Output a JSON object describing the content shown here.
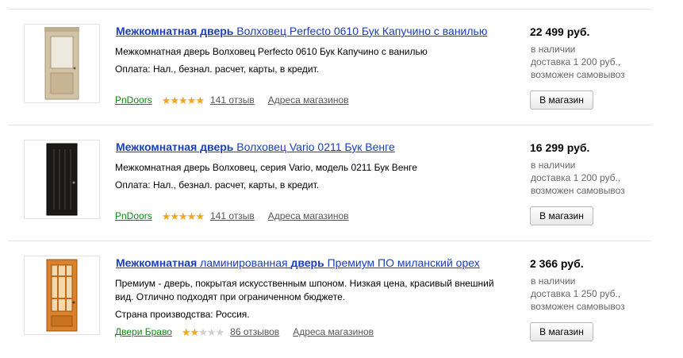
{
  "offers": [
    {
      "title_parts": [
        {
          "text": "Межкомнатная дверь",
          "bold": true
        },
        {
          "text": " Волховец Perfecto 0610 Бук Капучино с ванилью",
          "bold": false
        }
      ],
      "description": [
        "Межкомнатная дверь Волховец Perfecto 0610 Бук Капучино с ванилью",
        "Оплата: Нал., безнал. расчет, карты, в кредит."
      ],
      "shop": "PnDoors",
      "rating": 5,
      "reviews": "141 отзыв",
      "address_link": "Адреса магазинов",
      "price": "22 499 руб.",
      "availability": [
        "в наличии",
        "доставка 1 200 руб.,",
        "возможен самовывоз"
      ],
      "button": "В магазин",
      "door_color": "#c9b79a",
      "door_icon": "door-light-panel-icon"
    },
    {
      "title_parts": [
        {
          "text": "Межкомнатная дверь",
          "bold": true
        },
        {
          "text": " Волховец Vario 0211 Бук Венге",
          "bold": false
        }
      ],
      "description": [
        "Межкомнатная дверь Волховец, серия Vario, модель 0211 Бук Венге",
        "Оплата: Нал., безнал. расчет, карты, в кредит."
      ],
      "shop": "PnDoors",
      "rating": 5,
      "reviews": "141 отзыв",
      "address_link": "Адреса магазинов",
      "price": "16 299 руб.",
      "availability": [
        "в наличии",
        "доставка 1 200 руб.,",
        "возможен самовывоз"
      ],
      "button": "В магазин",
      "door_color": "#1c1a18",
      "door_icon": "door-dark-grooved-icon"
    },
    {
      "title_parts": [
        {
          "text": "Межкомнатная",
          "bold": true
        },
        {
          "text": " ламинированная ",
          "bold": false
        },
        {
          "text": "дверь",
          "bold": true
        },
        {
          "text": " Премиум ПО миланский орех",
          "bold": false
        }
      ],
      "description": [
        "Премиум - дверь, покрытая искусственным шпоном. Низкая цена, красивый внешний вид. Отлично подходят при ограниченном бюджете.",
        "Страна производства: Россия."
      ],
      "shop": "Двери Браво",
      "rating": 2,
      "reviews": "86 отзывов",
      "address_link": "Адреса магазинов",
      "price": "2 366 руб.",
      "availability": [
        "в наличии",
        "доставка 1 250 руб.,",
        "возможен самовывоз"
      ],
      "button": "В магазин",
      "door_color": "#d9822b",
      "door_icon": "door-orange-glass-icon"
    }
  ]
}
